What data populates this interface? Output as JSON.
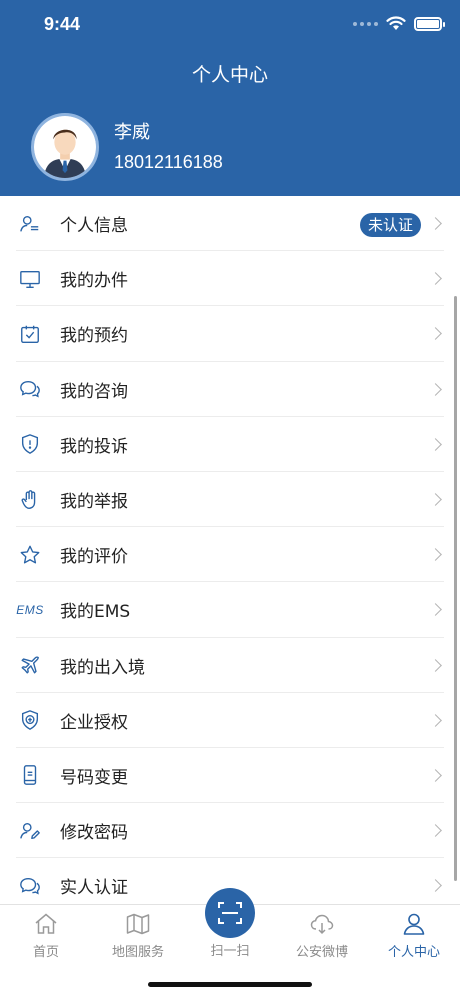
{
  "status_bar": {
    "time": "9:44"
  },
  "header": {
    "title": "个人中心",
    "user": {
      "name": "李威",
      "phone": "18012116188"
    }
  },
  "menu": {
    "items": [
      {
        "label": "个人信息",
        "icon": "user-info-icon",
        "badge": "未认证"
      },
      {
        "label": "我的办件",
        "icon": "monitor-icon"
      },
      {
        "label": "我的预约",
        "icon": "calendar-check-icon"
      },
      {
        "label": "我的咨询",
        "icon": "chat-bubbles-icon"
      },
      {
        "label": "我的投诉",
        "icon": "shield-alert-icon"
      },
      {
        "label": "我的举报",
        "icon": "raised-hand-icon"
      },
      {
        "label": "我的评价",
        "icon": "star-icon"
      },
      {
        "label": "我的EMS",
        "icon": "ems-icon",
        "icon_text": "EMS"
      },
      {
        "label": "我的出入境",
        "icon": "airplane-icon"
      },
      {
        "label": "企业授权",
        "icon": "enterprise-shield-icon"
      },
      {
        "label": "号码变更",
        "icon": "phone-icon"
      },
      {
        "label": "修改密码",
        "icon": "edit-password-icon"
      },
      {
        "label": "实人认证",
        "icon": "chat-bubbles-icon"
      }
    ]
  },
  "tabbar": {
    "tabs": [
      {
        "label": "首页",
        "icon": "home-icon"
      },
      {
        "label": "地图服务",
        "icon": "map-icon"
      },
      {
        "label": "扫一扫",
        "icon": "scan-icon"
      },
      {
        "label": "公安微博",
        "icon": "cloud-icon"
      },
      {
        "label": "个人中心",
        "icon": "person-icon",
        "active": true
      }
    ]
  },
  "colors": {
    "primary": "#2a64a7",
    "tab_inactive": "#8a8a8a",
    "chevron": "#b5b5b5"
  }
}
